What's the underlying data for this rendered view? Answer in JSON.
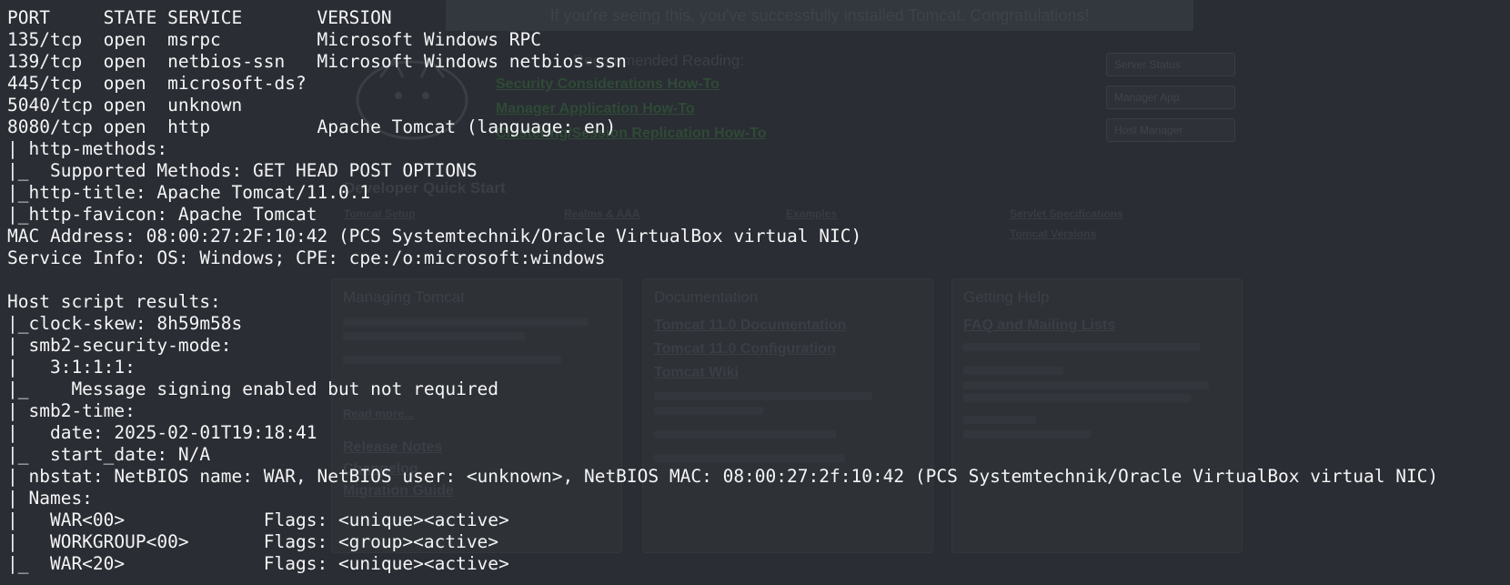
{
  "background_page": {
    "banner": "If you're seeing this, you've successfully installed Tomcat. Congratulations!",
    "recommended_heading": "Recommended Reading:",
    "recommended_links": [
      "Security Considerations How-To",
      "Manager Application How-To",
      "Clustering/Session Replication How-To"
    ],
    "side_buttons": [
      "Server Status",
      "Manager App",
      "Host Manager"
    ],
    "developer_quick_start": {
      "title": "Developer Quick Start",
      "links": [
        "Tomcat Setup",
        "Realms & AAA",
        "Examples",
        "Servlet Specifications",
        "Tomcat Versions"
      ]
    },
    "panels": [
      {
        "title": "Managing Tomcat",
        "items": [
          "Read more...",
          "Release Notes",
          "Changelog",
          "Migration Guide"
        ]
      },
      {
        "title": "Documentation",
        "items": [
          "Tomcat 11.0 Documentation",
          "Tomcat 11.0 Configuration",
          "Tomcat Wiki"
        ]
      },
      {
        "title": "Getting Help",
        "items": [
          "FAQ and Mailing Lists"
        ]
      }
    ]
  },
  "terminal": {
    "lines": [
      "PORT     STATE SERVICE       VERSION",
      "135/tcp  open  msrpc         Microsoft Windows RPC",
      "139/tcp  open  netbios-ssn   Microsoft Windows netbios-ssn",
      "445/tcp  open  microsoft-ds?",
      "5040/tcp open  unknown",
      "8080/tcp open  http          Apache Tomcat (language: en)",
      "| http-methods:",
      "|_  Supported Methods: GET HEAD POST OPTIONS",
      "|_http-title: Apache Tomcat/11.0.1",
      "|_http-favicon: Apache Tomcat",
      "MAC Address: 08:00:27:2F:10:42 (PCS Systemtechnik/Oracle VirtualBox virtual NIC)",
      "Service Info: OS: Windows; CPE: cpe:/o:microsoft:windows",
      "",
      "Host script results:",
      "|_clock-skew: 8h59m58s",
      "| smb2-security-mode:",
      "|   3:1:1:1:",
      "|_    Message signing enabled but not required",
      "| smb2-time:",
      "|   date: 2025-02-01T19:18:41",
      "|_  start_date: N/A",
      "| nbstat: NetBIOS name: WAR, NetBIOS user: <unknown>, NetBIOS MAC: 08:00:27:2f:10:42 (PCS Systemtechnik/Oracle VirtualBox virtual NIC)",
      "| Names:",
      "|   WAR<00>             Flags: <unique><active>",
      "|   WORKGROUP<00>       Flags: <group><active>",
      "|_  WAR<20>             Flags: <unique><active>"
    ]
  },
  "colors": {
    "terminal_background": "#2a2d33",
    "terminal_text": "#f4f5f6"
  }
}
